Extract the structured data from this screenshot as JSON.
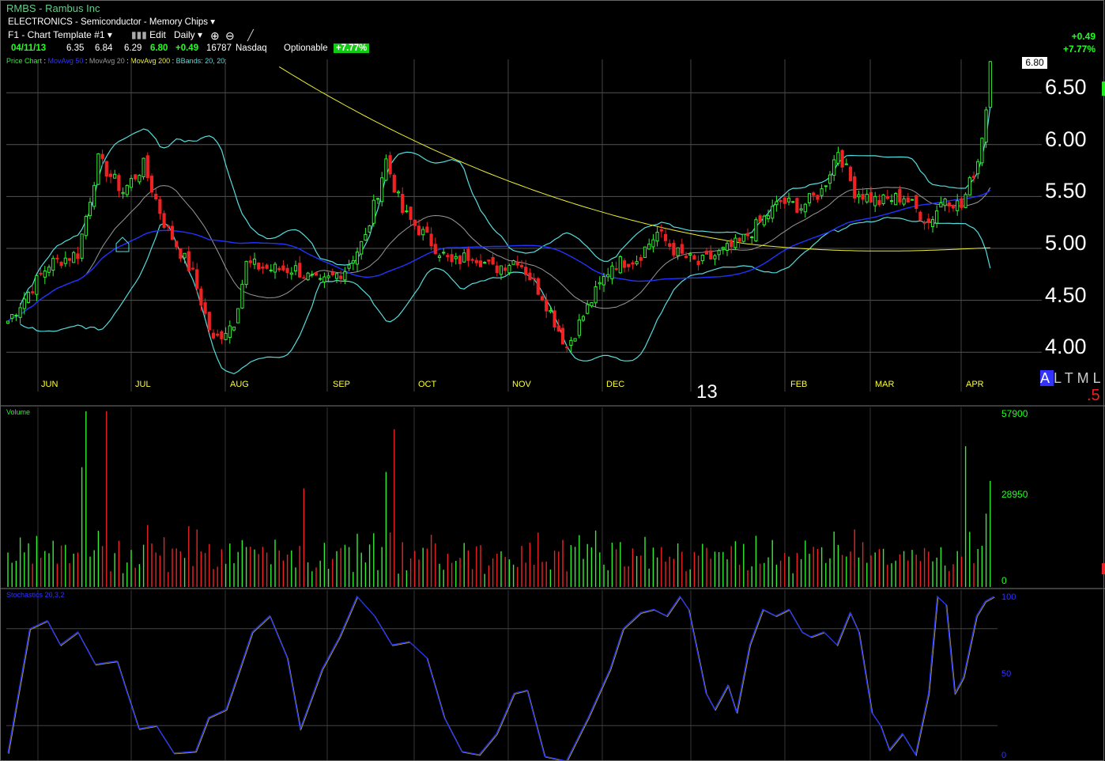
{
  "header": {
    "title": "RMBS - Rambus Inc",
    "sector": "ELECTRONICS - Semiconductor - Memory Chips ▾",
    "template": "F1 - Chart Template #1 ▾",
    "edit_label": "Edit",
    "period_label": "Daily ▾"
  },
  "quote": {
    "date": "04/11/13",
    "open": "6.35",
    "high": "6.84",
    "low": "6.29",
    "close": "6.80",
    "change": "+0.49",
    "volume": "16787",
    "exchange": "Nasdaq",
    "optionable": "Optionable",
    "pct_badge": "+7.77%"
  },
  "change_display": {
    "abs": "+0.49",
    "pct": "+7.77%"
  },
  "last_price_label": "6.80",
  "legend": {
    "price": "Price Chart",
    "ma50": "MovAvg 50",
    "ma20": "MovAvg 20",
    "ma200": "MovAvg 200",
    "bb": "BBands: 20, 20;"
  },
  "year_label": "13",
  "timeframe": {
    "a": "A",
    "rest": "LTML",
    "half": ".5"
  },
  "colors": {
    "up": "#33ee33",
    "down": "#ee2222",
    "ma50": "#2233ff",
    "ma20": "#999999",
    "ma200": "#eeee33",
    "bb": "#55dddd",
    "stoch": "#2233ff"
  },
  "volume_pane": {
    "label": "Volume",
    "ticks": [
      "57900",
      "28950",
      "0"
    ]
  },
  "stoch_pane": {
    "label": "Stochastics 20,3,2",
    "ticks": [
      "100",
      "50",
      "0"
    ]
  },
  "chart_data": {
    "type": "candlestick",
    "price_ticks": [
      "6.50",
      "6.00",
      "5.50",
      "5.00",
      "4.50",
      "4.00"
    ],
    "month_labels": [
      "JUN",
      "JUL",
      "AUG",
      "SEP",
      "OCT",
      "NOV",
      "DEC",
      "FEB",
      "MAR",
      "APR"
    ],
    "close_anchors": [
      [
        0,
        4.3
      ],
      [
        10,
        4.85
      ],
      [
        17,
        4.95
      ],
      [
        22,
        5.85
      ],
      [
        28,
        5.55
      ],
      [
        33,
        5.8
      ],
      [
        38,
        5.25
      ],
      [
        45,
        4.75
      ],
      [
        50,
        4.1
      ],
      [
        55,
        4.3
      ],
      [
        58,
        4.85
      ],
      [
        64,
        4.8
      ],
      [
        70,
        4.8
      ],
      [
        76,
        4.65
      ],
      [
        82,
        4.8
      ],
      [
        87,
        5.1
      ],
      [
        92,
        5.85
      ],
      [
        96,
        5.35
      ],
      [
        102,
        5.1
      ],
      [
        108,
        4.85
      ],
      [
        113,
        4.95
      ],
      [
        118,
        4.8
      ],
      [
        124,
        4.9
      ],
      [
        130,
        4.55
      ],
      [
        136,
        4.05
      ],
      [
        142,
        4.5
      ],
      [
        147,
        4.85
      ],
      [
        153,
        4.9
      ],
      [
        158,
        5.15
      ],
      [
        163,
        4.95
      ],
      [
        168,
        4.85
      ],
      [
        173,
        4.95
      ],
      [
        178,
        5.05
      ],
      [
        183,
        5.25
      ],
      [
        188,
        5.45
      ],
      [
        193,
        5.4
      ],
      [
        198,
        5.55
      ],
      [
        202,
        5.95
      ],
      [
        206,
        5.55
      ],
      [
        212,
        5.45
      ],
      [
        218,
        5.5
      ],
      [
        224,
        5.25
      ],
      [
        228,
        5.5
      ],
      [
        232,
        5.4
      ],
      [
        236,
        5.85
      ],
      [
        238,
        6.35
      ],
      [
        239,
        6.8
      ]
    ],
    "volume_range": [
      0,
      57900
    ],
    "stoch_range": [
      0,
      100
    ],
    "stoch_anchors": [
      [
        0,
        3
      ],
      [
        5,
        80
      ],
      [
        9,
        85
      ],
      [
        12,
        70
      ],
      [
        16,
        78
      ],
      [
        20,
        58
      ],
      [
        25,
        60
      ],
      [
        30,
        18
      ],
      [
        34,
        20
      ],
      [
        38,
        3
      ],
      [
        43,
        4
      ],
      [
        46,
        25
      ],
      [
        50,
        30
      ],
      [
        56,
        78
      ],
      [
        60,
        88
      ],
      [
        64,
        62
      ],
      [
        67,
        18
      ],
      [
        72,
        55
      ],
      [
        76,
        75
      ],
      [
        80,
        100
      ],
      [
        84,
        88
      ],
      [
        88,
        70
      ],
      [
        92,
        72
      ],
      [
        96,
        62
      ],
      [
        100,
        25
      ],
      [
        104,
        4
      ],
      [
        108,
        2
      ],
      [
        112,
        15
      ],
      [
        116,
        40
      ],
      [
        119,
        42
      ],
      [
        123,
        1
      ],
      [
        128,
        -2
      ],
      [
        133,
        25
      ],
      [
        138,
        55
      ],
      [
        141,
        80
      ],
      [
        145,
        90
      ],
      [
        148,
        92
      ],
      [
        151,
        88
      ],
      [
        154,
        100
      ],
      [
        156,
        92
      ],
      [
        160,
        40
      ],
      [
        162,
        30
      ],
      [
        165,
        45
      ],
      [
        167,
        28
      ],
      [
        170,
        70
      ],
      [
        173,
        92
      ],
      [
        176,
        88
      ],
      [
        179,
        92
      ],
      [
        182,
        78
      ],
      [
        184,
        75
      ],
      [
        187,
        78
      ],
      [
        190,
        70
      ],
      [
        193,
        90
      ],
      [
        195,
        78
      ],
      [
        198,
        28
      ],
      [
        200,
        20
      ],
      [
        202,
        5
      ],
      [
        205,
        15
      ],
      [
        208,
        2
      ],
      [
        211,
        40
      ],
      [
        213,
        100
      ],
      [
        215,
        95
      ],
      [
        217,
        40
      ],
      [
        219,
        50
      ],
      [
        222,
        88
      ],
      [
        224,
        97
      ],
      [
        226,
        100
      ]
    ]
  }
}
